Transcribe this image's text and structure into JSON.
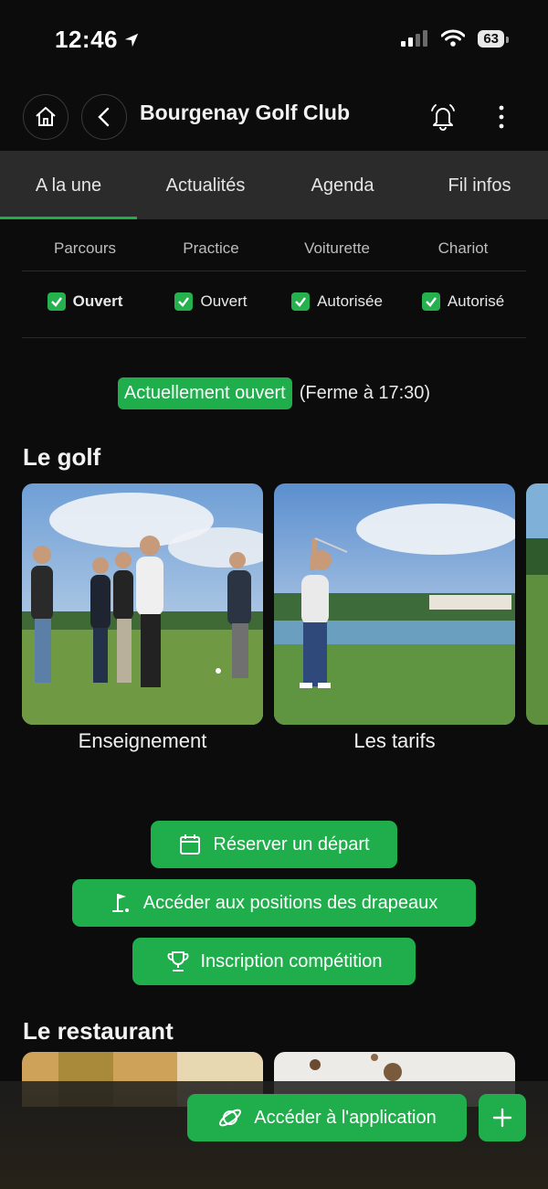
{
  "status_bar": {
    "time": "12:46",
    "battery": "63"
  },
  "header": {
    "title": "Bourgenay Golf Club"
  },
  "tabs": [
    {
      "label": "A la une",
      "active": true
    },
    {
      "label": "Actualités"
    },
    {
      "label": "Agenda"
    },
    {
      "label": "Fil infos"
    }
  ],
  "course_status": {
    "headers": [
      "Parcours",
      "Practice",
      "Voiturette",
      "Chariot"
    ],
    "values": [
      "Ouvert",
      "Ouvert",
      "Autorisée",
      "Autorisé"
    ]
  },
  "opening": {
    "badge": "Actuellement ouvert",
    "detail": "(Ferme à 17:30)"
  },
  "golf_section": {
    "title": "Le golf",
    "cards": [
      {
        "label": "Enseignement"
      },
      {
        "label": "Les tarifs"
      }
    ]
  },
  "actions": {
    "book": "Réserver un départ",
    "flags": "Accéder aux positions des drapeaux",
    "competition": "Inscription compétition"
  },
  "restaurant_section": {
    "title": "Le restaurant"
  },
  "footer": {
    "app_button": "Accéder à l'application"
  },
  "colors": {
    "accent": "#1fae4b",
    "background": "#0c0c0c",
    "tab_bar": "#2b2b2b"
  }
}
